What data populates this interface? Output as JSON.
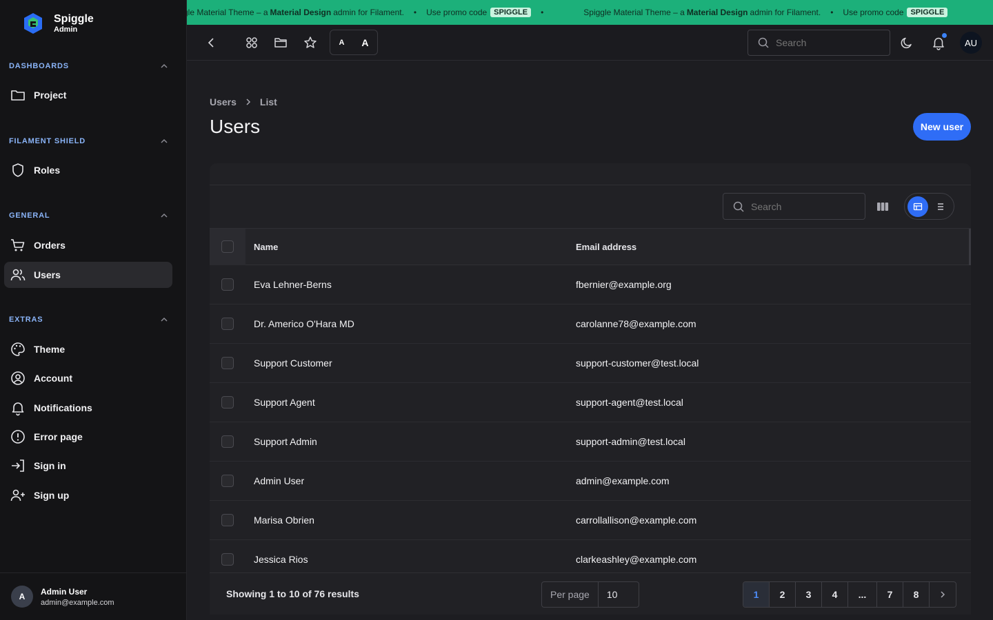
{
  "brand": {
    "name": "Spiggle",
    "subtitle": "Admin"
  },
  "sidebar": {
    "groups": [
      {
        "label": "DASHBOARDS",
        "items": [
          {
            "label": "Project",
            "icon": "folder-icon"
          }
        ]
      },
      {
        "label": "FILAMENT SHIELD",
        "items": [
          {
            "label": "Roles",
            "icon": "shield-icon"
          }
        ]
      },
      {
        "label": "GENERAL",
        "items": [
          {
            "label": "Orders",
            "icon": "cart-icon"
          },
          {
            "label": "Users",
            "icon": "users-icon",
            "active": true
          }
        ]
      },
      {
        "label": "EXTRAS",
        "items": [
          {
            "label": "Theme",
            "icon": "palette-icon"
          },
          {
            "label": "Account",
            "icon": "user-circle-icon"
          },
          {
            "label": "Notifications",
            "icon": "bell-icon"
          },
          {
            "label": "Error page",
            "icon": "alert-circle-icon"
          },
          {
            "label": "Sign in",
            "icon": "sign-in-icon"
          },
          {
            "label": "Sign up",
            "icon": "user-plus-icon"
          }
        ]
      }
    ],
    "footer": {
      "avatar_initial": "A",
      "name": "Admin User",
      "email": "admin@example.com"
    }
  },
  "promo": {
    "segments": [
      {
        "lead": "gle Material Theme – a",
        "bold": "Material Design",
        "tail": "admin for Filament.",
        "cta": "Use promo code",
        "code": "SPIGGLE"
      },
      {
        "lead": "Spiggle Material Theme – a",
        "bold": "Material Design",
        "tail": "admin for Filament.",
        "cta": "Use promo code",
        "code": "SPIGGLE"
      }
    ],
    "separator": "•",
    "color": "#1cb07a"
  },
  "topbar": {
    "font_small": "A",
    "font_large": "A",
    "search_placeholder": "Search",
    "avatar": "AU"
  },
  "main": {
    "breadcrumb": [
      "Users",
      "List"
    ],
    "title": "Users",
    "new_button": "New user",
    "table": {
      "search_placeholder": "Search",
      "columns": [
        "Name",
        "Email address"
      ],
      "rows": [
        {
          "name": "Eva Lehner-Berns",
          "email": "fbernier@example.org"
        },
        {
          "name": "Dr. Americo O'Hara MD",
          "email": "carolanne78@example.com"
        },
        {
          "name": "Support Customer",
          "email": "support-customer@test.local"
        },
        {
          "name": "Support Agent",
          "email": "support-agent@test.local"
        },
        {
          "name": "Support Admin",
          "email": "support-admin@test.local"
        },
        {
          "name": "Admin User",
          "email": "admin@example.com"
        },
        {
          "name": "Marisa Obrien",
          "email": "carrollallison@example.com"
        },
        {
          "name": "Jessica Rios",
          "email": "clarkeashley@example.com"
        }
      ]
    },
    "footer": {
      "results": "Showing 1 to 10 of 76 results",
      "per_page_label": "Per page",
      "per_page_value": "10",
      "pages": [
        "1",
        "2",
        "3",
        "4",
        "...",
        "7",
        "8"
      ],
      "current_page": "1"
    }
  },
  "colors": {
    "accent": "#2f6df6",
    "sidebar_group": "#8ab4f8",
    "background": "#1d1d21"
  }
}
